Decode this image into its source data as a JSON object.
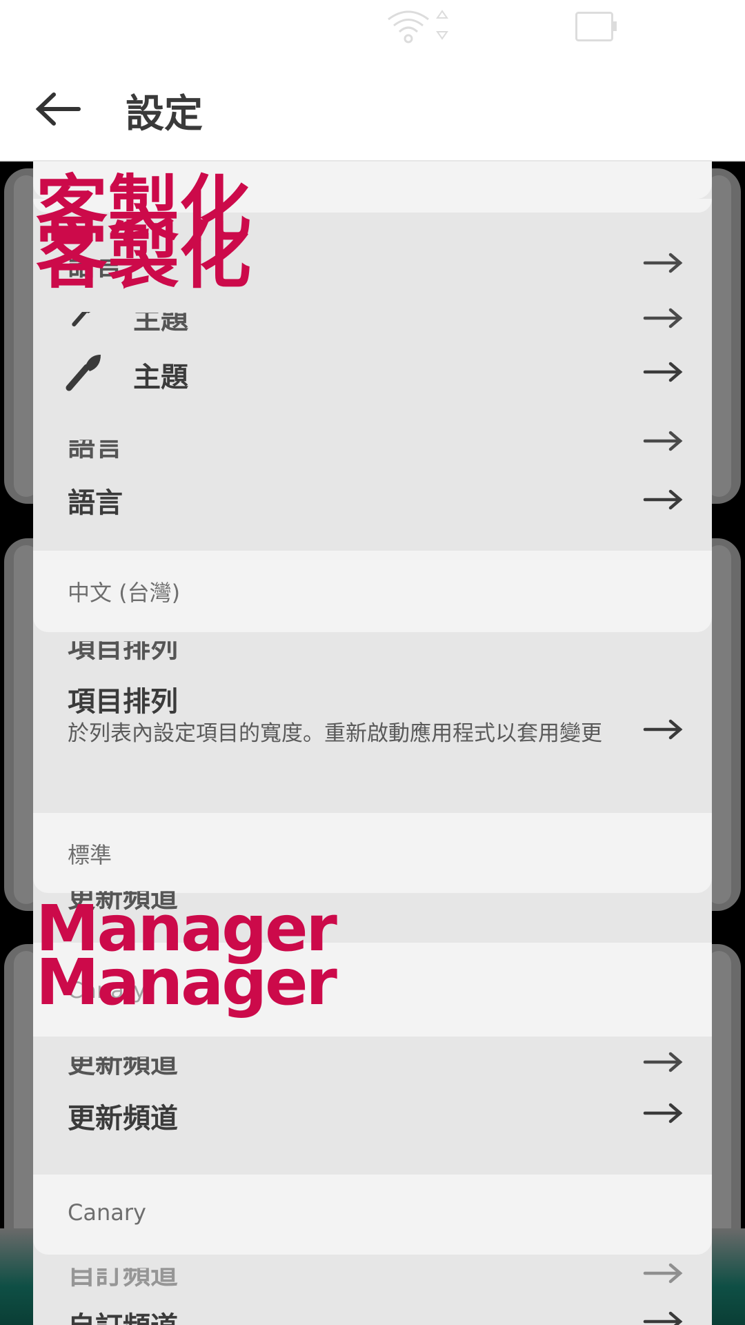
{
  "appbar": {
    "title": "設定"
  },
  "sections": {
    "customization_title": "客製化",
    "manager_title": "Manager"
  },
  "items": {
    "theme_label": "主題",
    "language_label": "語言",
    "language_value": "中文 (台灣)",
    "layout_label": "項目排列",
    "layout_desc": "於列表內設定項目的寬度。重新啟動應用程式以套用變更",
    "layout_value": "標準",
    "channel_label": "更新頻道",
    "channel_value": "Canary",
    "custom_channel_label": "自訂頻道"
  },
  "colors": {
    "accent": "#cc0a4a",
    "teal": "#0f4f45"
  }
}
